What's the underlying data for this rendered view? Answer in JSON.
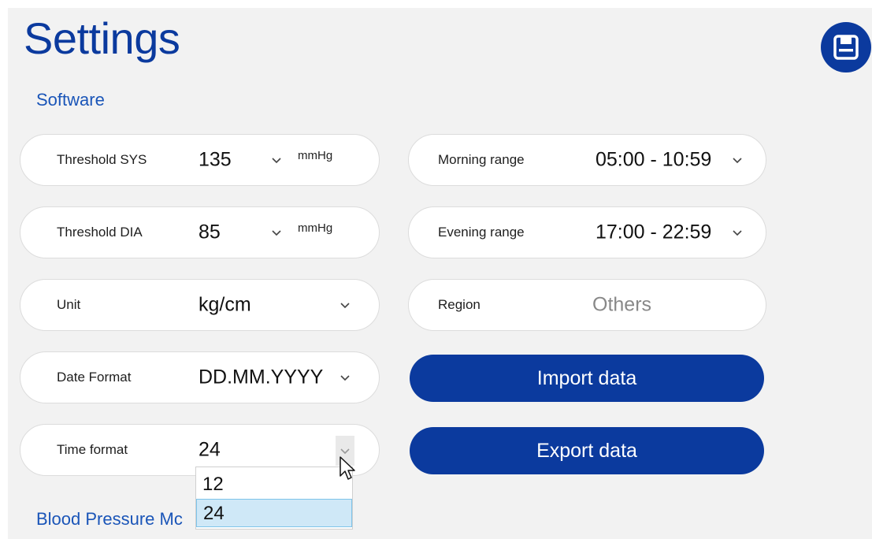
{
  "page": {
    "title": "Settings"
  },
  "toolbar": {
    "save_icon": "floppy-disk-icon"
  },
  "sections": {
    "software": "Software",
    "blood_pressure": "Blood Pressure Mc"
  },
  "software": {
    "threshold_sys": {
      "label": "Threshold SYS",
      "value": "135",
      "unit": "mmHg"
    },
    "threshold_dia": {
      "label": "Threshold DIA",
      "value": "85",
      "unit": "mmHg"
    },
    "unit": {
      "label": "Unit",
      "value": "kg/cm"
    },
    "date_format": {
      "label": "Date Format",
      "value": "DD.MM.YYYY"
    },
    "time_format": {
      "label": "Time format",
      "value": "24",
      "options": [
        "12",
        "24"
      ],
      "selected": "24"
    },
    "morning_range": {
      "label": "Morning range",
      "value": "05:00 - 10:59"
    },
    "evening_range": {
      "label": "Evening range",
      "value": "17:00 - 22:59"
    },
    "region": {
      "label": "Region",
      "value": "Others"
    }
  },
  "actions": {
    "import": "Import data",
    "export": "Export data"
  },
  "colors": {
    "brand": "#0b3a9e",
    "section": "#1a55b8",
    "selection": "#cfe8f7"
  }
}
